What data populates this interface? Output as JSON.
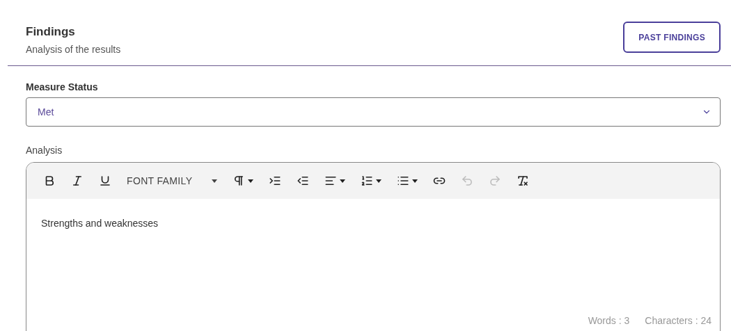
{
  "header": {
    "title": "Findings",
    "subtitle": "Analysis of the results",
    "button": "PAST FINDINGS"
  },
  "measure_status": {
    "label": "Measure Status",
    "value": "Met"
  },
  "analysis": {
    "label": "Analysis",
    "toolbar": [
      {
        "kind": "bold",
        "disabled": false
      },
      {
        "kind": "italic",
        "disabled": false
      },
      {
        "kind": "underline",
        "disabled": false
      },
      {
        "kind": "font_family",
        "label": "FONT FAMILY",
        "disabled": false
      },
      {
        "kind": "paragraph",
        "disabled": false
      },
      {
        "kind": "indent",
        "disabled": false
      },
      {
        "kind": "outdent",
        "disabled": false
      },
      {
        "kind": "align",
        "disabled": false
      },
      {
        "kind": "ordered_list",
        "disabled": false
      },
      {
        "kind": "bullet_list",
        "disabled": false
      },
      {
        "kind": "link",
        "disabled": false
      },
      {
        "kind": "undo",
        "disabled": true
      },
      {
        "kind": "redo",
        "disabled": true
      },
      {
        "kind": "clear_format",
        "disabled": false
      }
    ],
    "content": "Strengths and weaknesses",
    "word_count": "Words : 3",
    "char_count": "Characters : 24"
  }
}
